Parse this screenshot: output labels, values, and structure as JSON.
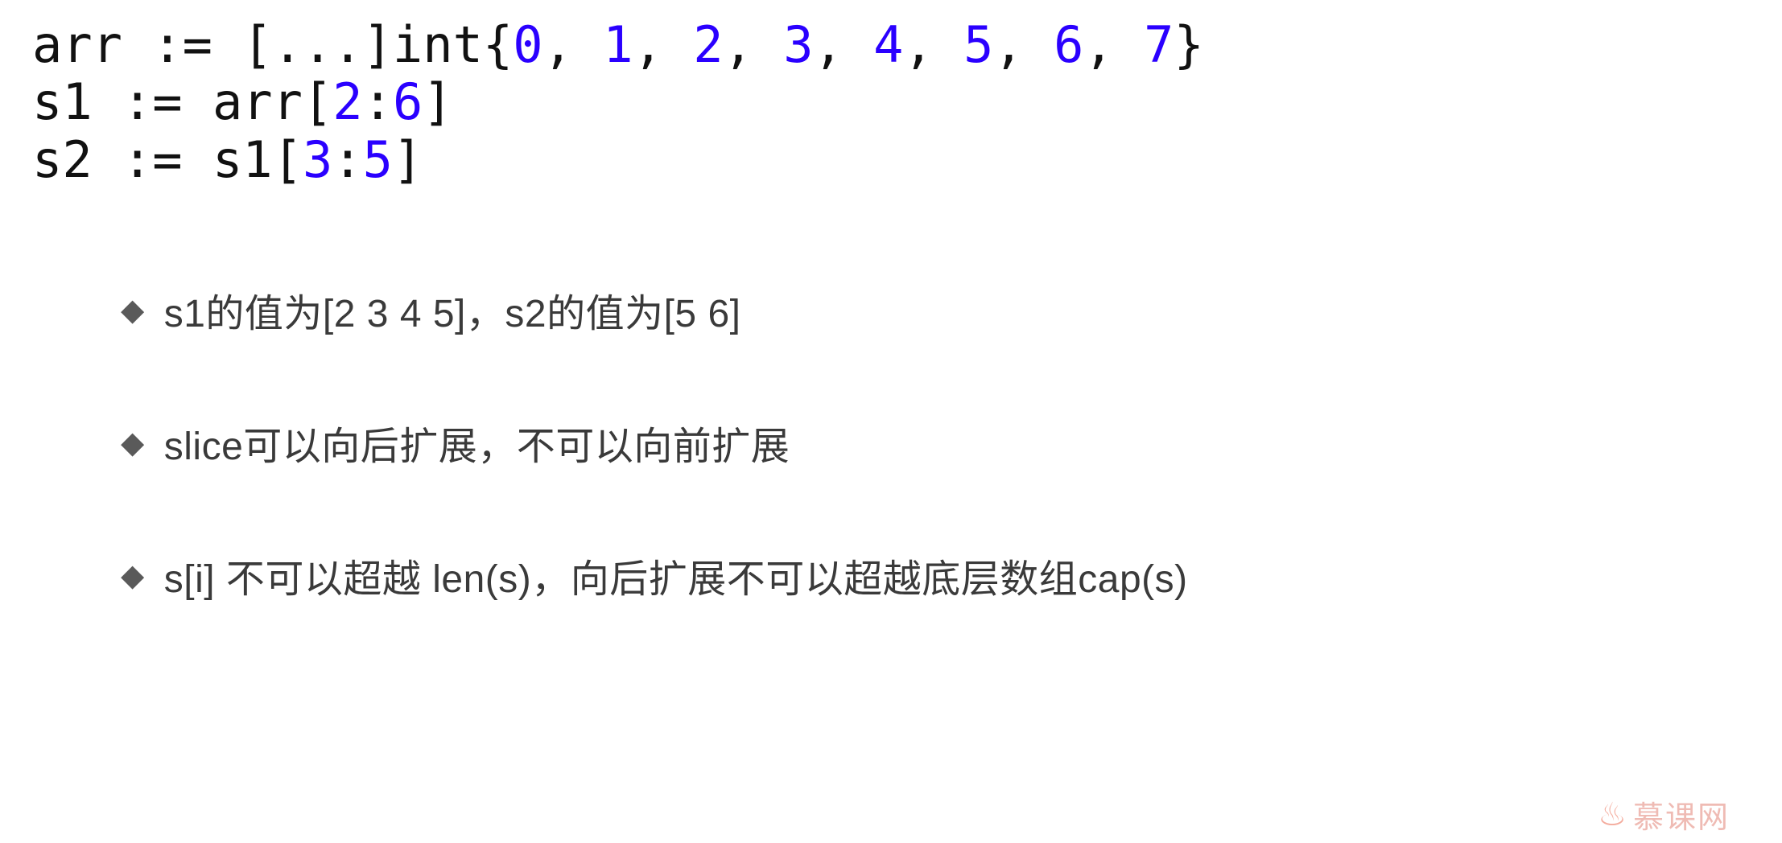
{
  "code": {
    "line1_pre": "arr := [...]int{",
    "line1_vals": [
      "0",
      "1",
      "2",
      "3",
      "4",
      "5",
      "6",
      "7"
    ],
    "line1_sep": ", ",
    "line1_post": "}",
    "line2_pre": "s1 := arr[",
    "line2_a": "2",
    "line2_colon": ":",
    "line2_b": "6",
    "line2_post": "]",
    "line3_pre": "s2 := s1[",
    "line3_a": "3",
    "line3_colon": ":",
    "line3_b": "5",
    "line3_post": "]"
  },
  "bullets": [
    "s1的值为[2 3 4 5]，s2的值为[5 6]",
    "slice可以向后扩展，不可以向前扩展",
    "s[i] 不可以超越 len(s)，向后扩展不可以超越底层数组cap(s)"
  ],
  "watermark": "慕课网"
}
